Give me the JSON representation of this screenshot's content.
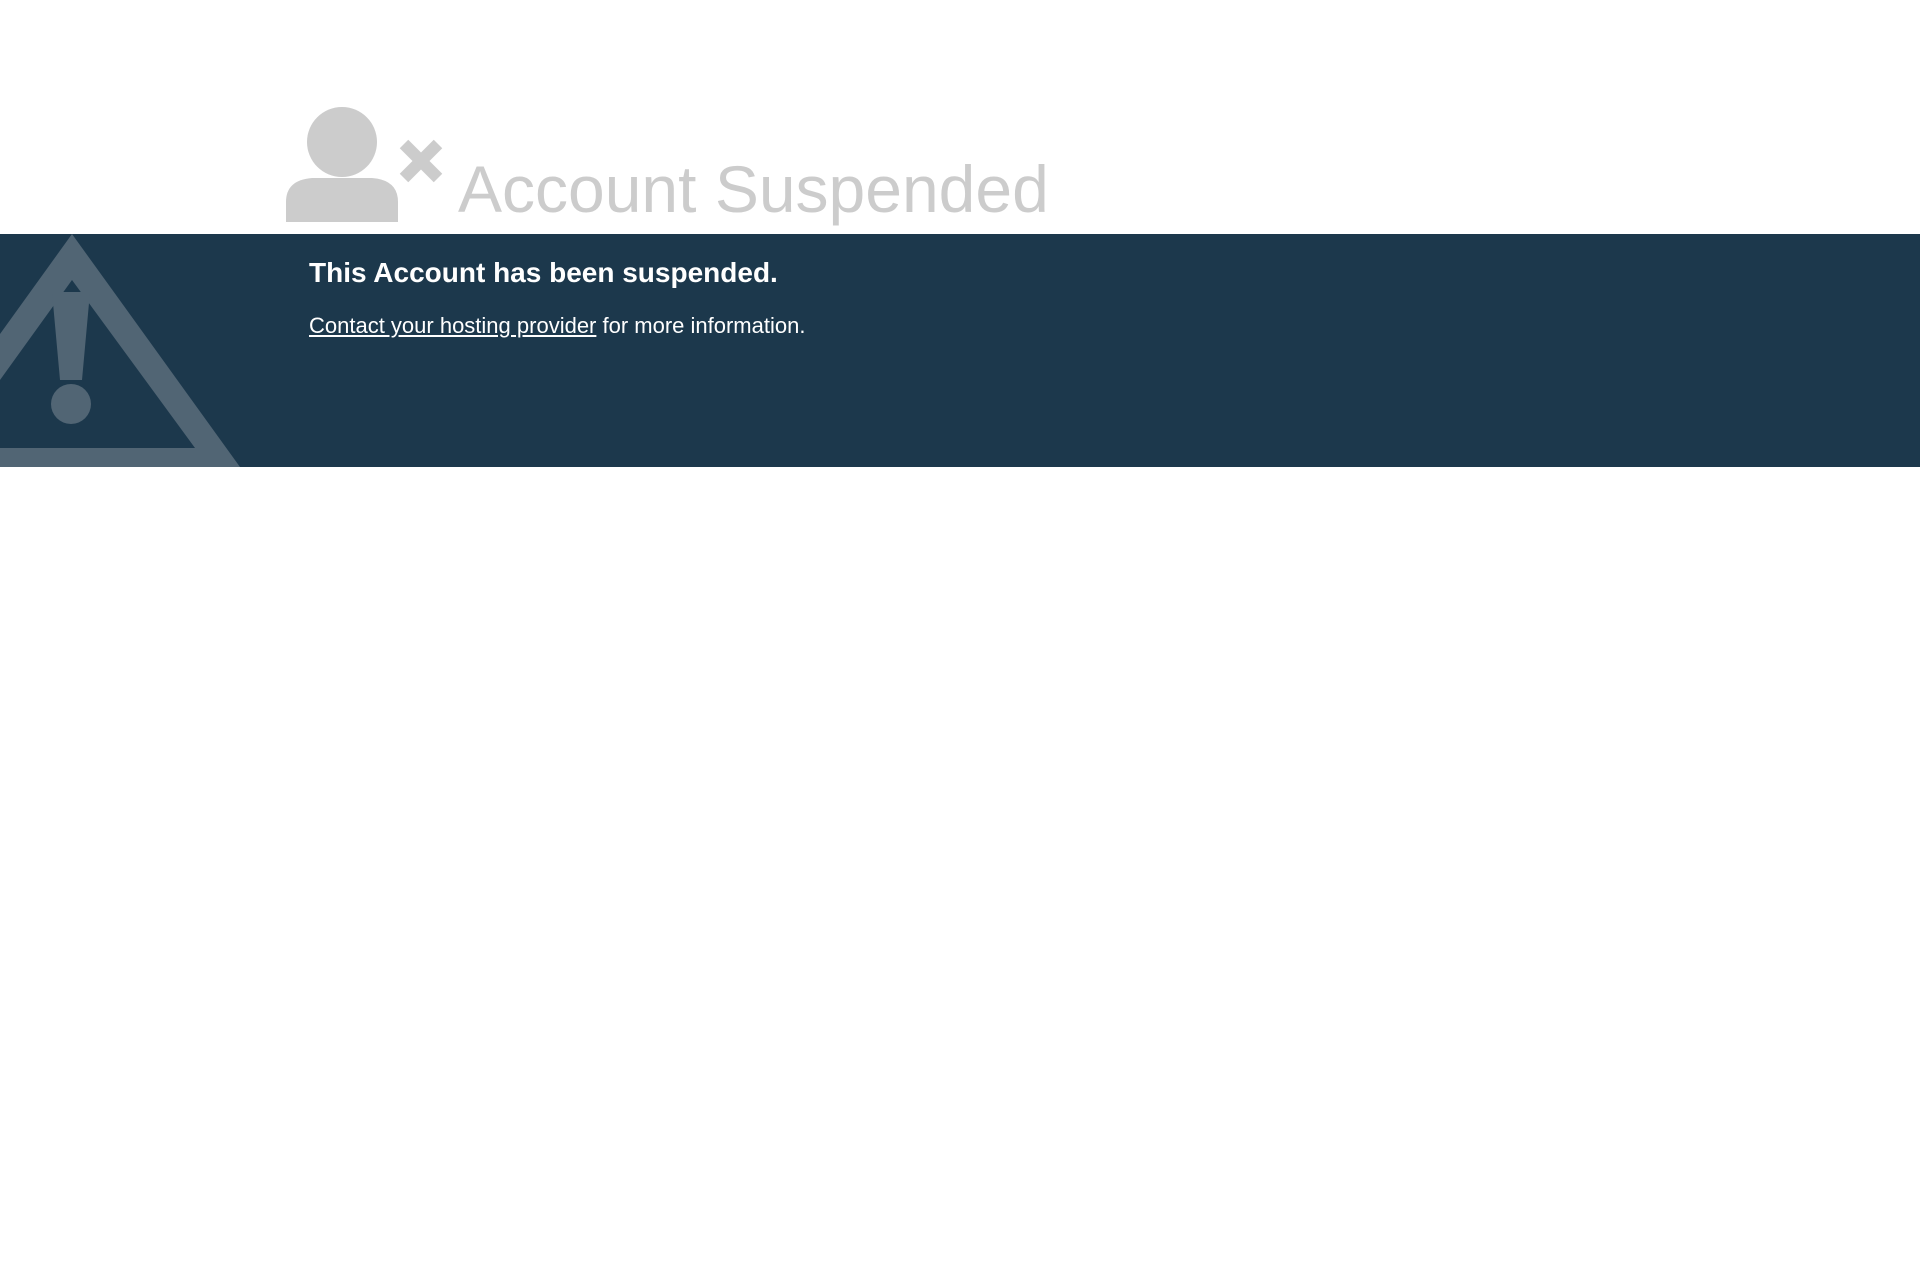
{
  "header": {
    "title": "Account Suspended",
    "icon": "user-suspended-icon"
  },
  "banner": {
    "icon": "warning-icon",
    "heading": "This Account has been suspended.",
    "link_text": "Contact your hosting provider",
    "trailing_text": " for more information."
  },
  "colors": {
    "background": "#ffffff",
    "banner_background": "#1c384c",
    "title_text": "#cccccc",
    "icon_gray": "#cccccc",
    "warning_icon": "#516574",
    "banner_text": "#ffffff"
  }
}
